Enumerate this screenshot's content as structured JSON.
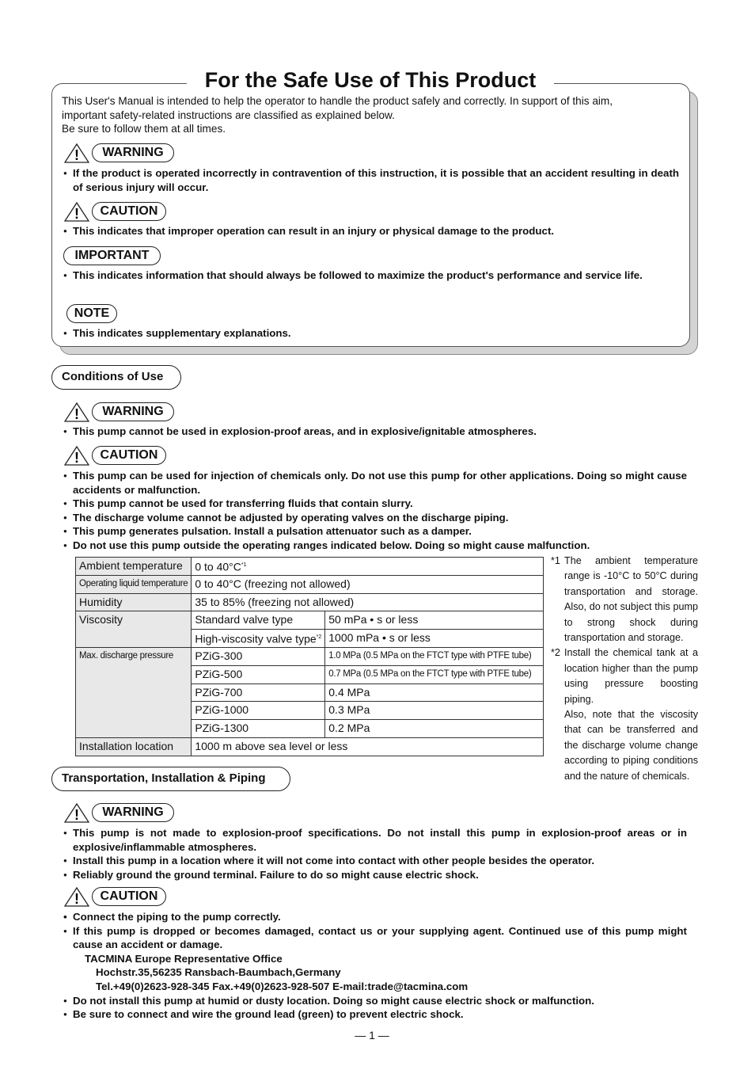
{
  "title": "For the Safe Use of This Product",
  "intro": [
    "This User's Manual is intended to help the operator to handle the product safely and correctly. In support of this aim,",
    "important safety-related instructions are classified as explained below.",
    "Be sure to follow them at all times."
  ],
  "labels": {
    "warning": "WARNING",
    "caution": "CAUTION",
    "important": "IMPORTANT",
    "note": "NOTE"
  },
  "legend": {
    "warning": "If the product is operated incorrectly in contravention of this instruction, it is possible that an accident resulting in death of serious injury will occur.",
    "caution": "This indicates that improper operation can result in an injury or physical damage to the product.",
    "important": "This indicates information that should always be followed to maximize the product's performance and service life.",
    "note": "This indicates supplementary explanations."
  },
  "conditions": {
    "heading": "Conditions of Use",
    "warning": [
      "This pump cannot be used in explosion-proof areas, and in explosive/ignitable atmospheres."
    ],
    "caution": [
      "This pump can be used for injection of chemicals only. Do not use this pump for other applications. Doing so might cause accidents or malfunction.",
      "This pump cannot be used for transferring fluids that contain slurry.",
      "The discharge volume cannot be adjusted by operating valves on the discharge piping.",
      "This pump generates pulsation. Install a pulsation attenuator such as a damper.",
      "Do not use this pump outside the operating ranges indicated below. Doing so might cause malfunction."
    ]
  },
  "table": {
    "ambient": [
      "Ambient temperature",
      "0 to 40°C",
      "*1"
    ],
    "liquid": [
      "Operating liquid temperature",
      "0 to 40°C (freezing not allowed)"
    ],
    "humidity": [
      "Humidity",
      "35 to 85% (freezing not allowed)"
    ],
    "viscosity": {
      "label": "Viscosity",
      "rows": [
        [
          "Standard valve type",
          "",
          "50 mPa • s or less"
        ],
        [
          "High-viscosity valve type",
          "*2",
          "1000 mPa • s or less"
        ]
      ]
    },
    "pressure": {
      "label": "Max. discharge pressure",
      "rows": [
        [
          "PZiG-300",
          "1.0 MPa (0.5 MPa on the FTCT type with PTFE tube)"
        ],
        [
          "PZiG-500",
          "0.7 MPa (0.5 MPa on the FTCT type with PTFE tube)"
        ],
        [
          "PZiG-700",
          "0.4 MPa"
        ],
        [
          "PZiG-1000",
          "0.3 MPa"
        ],
        [
          "PZiG-1300",
          "0.2 MPa"
        ]
      ]
    },
    "installation": [
      "Installation location",
      "1000 m above sea level or less"
    ]
  },
  "footnotes": [
    {
      "mark": "*1",
      "text": "The ambient temperature range is -10°C to 50°C during transportation and storage. Also, do not subject this pump to strong shock during transportation and storage."
    },
    {
      "mark": "*2",
      "text": "Install the chemical tank at a location higher than the pump using pressure boosting piping.",
      "text2": "Also, note that the viscosity that can be transferred and the discharge volume change according to piping conditions and the nature of chemicals."
    }
  ],
  "transport": {
    "heading": "Transportation, Installation & Piping",
    "warning": [
      "This pump is not made to explosion-proof specifications. Do not install this pump in explosion-proof areas or in explosive/inflammable atmospheres.",
      "Install this pump in a location where it will not come into contact with other people besides the operator.",
      "Reliably ground the ground terminal. Failure to do so might cause electric shock."
    ],
    "caution": [
      "Connect the piping to the pump correctly.",
      "If this pump is dropped or becomes damaged, contact us or your supplying agent. Continued use of this pump might cause an accident or damage."
    ],
    "address": [
      "TACMINA Europe Representative Office",
      "Hochstr.35,56235 Ransbach-Baumbach,Germany",
      "Tel.+49(0)2623-928-345   Fax.+49(0)2623-928-507   E-mail:trade@tacmina.com"
    ],
    "caution2": [
      "Do not install this pump at humid or dusty location. Doing so might cause electric shock or malfunction.",
      "Be sure to connect and wire the ground lead (green) to prevent electric shock."
    ]
  },
  "page_number": "— 1 —"
}
